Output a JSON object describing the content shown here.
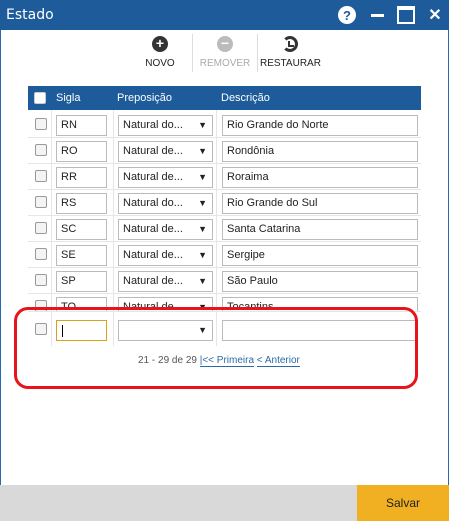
{
  "window": {
    "title": "Estado",
    "controls": {
      "help": "?",
      "close": "✕"
    }
  },
  "toolbar": {
    "new_label": "NOVO",
    "remove_label": "REMOVER",
    "restore_label": "RESTAURAR"
  },
  "grid": {
    "headers": {
      "sigla": "Sigla",
      "preposicao": "Preposição",
      "descricao": "Descrição"
    },
    "rows": [
      {
        "sigla": "RN",
        "preposicao": "Natural do...",
        "descricao": "Rio Grande do Norte"
      },
      {
        "sigla": "RO",
        "preposicao": "Natural de...",
        "descricao": "Rondônia"
      },
      {
        "sigla": "RR",
        "preposicao": "Natural de...",
        "descricao": "Roraima"
      },
      {
        "sigla": "RS",
        "preposicao": "Natural do...",
        "descricao": "Rio Grande do Sul"
      },
      {
        "sigla": "SC",
        "preposicao": "Natural de...",
        "descricao": "Santa Catarina"
      },
      {
        "sigla": "SE",
        "preposicao": "Natural de...",
        "descricao": "Sergipe"
      },
      {
        "sigla": "SP",
        "preposicao": "Natural de...",
        "descricao": "São Paulo"
      },
      {
        "sigla": "TO",
        "preposicao": "Natural de...",
        "descricao": "Tocantins"
      }
    ],
    "new_row": {
      "sigla": "",
      "preposicao": "",
      "descricao": ""
    }
  },
  "pager": {
    "range": "21 - 29 de 29",
    "first": "|<< Primeira",
    "previous": "< Anterior"
  },
  "footer": {
    "save_label": "Salvar"
  },
  "colors": {
    "header": "#1d5b9a",
    "save": "#f1b021",
    "highlight": "#e8141c"
  }
}
